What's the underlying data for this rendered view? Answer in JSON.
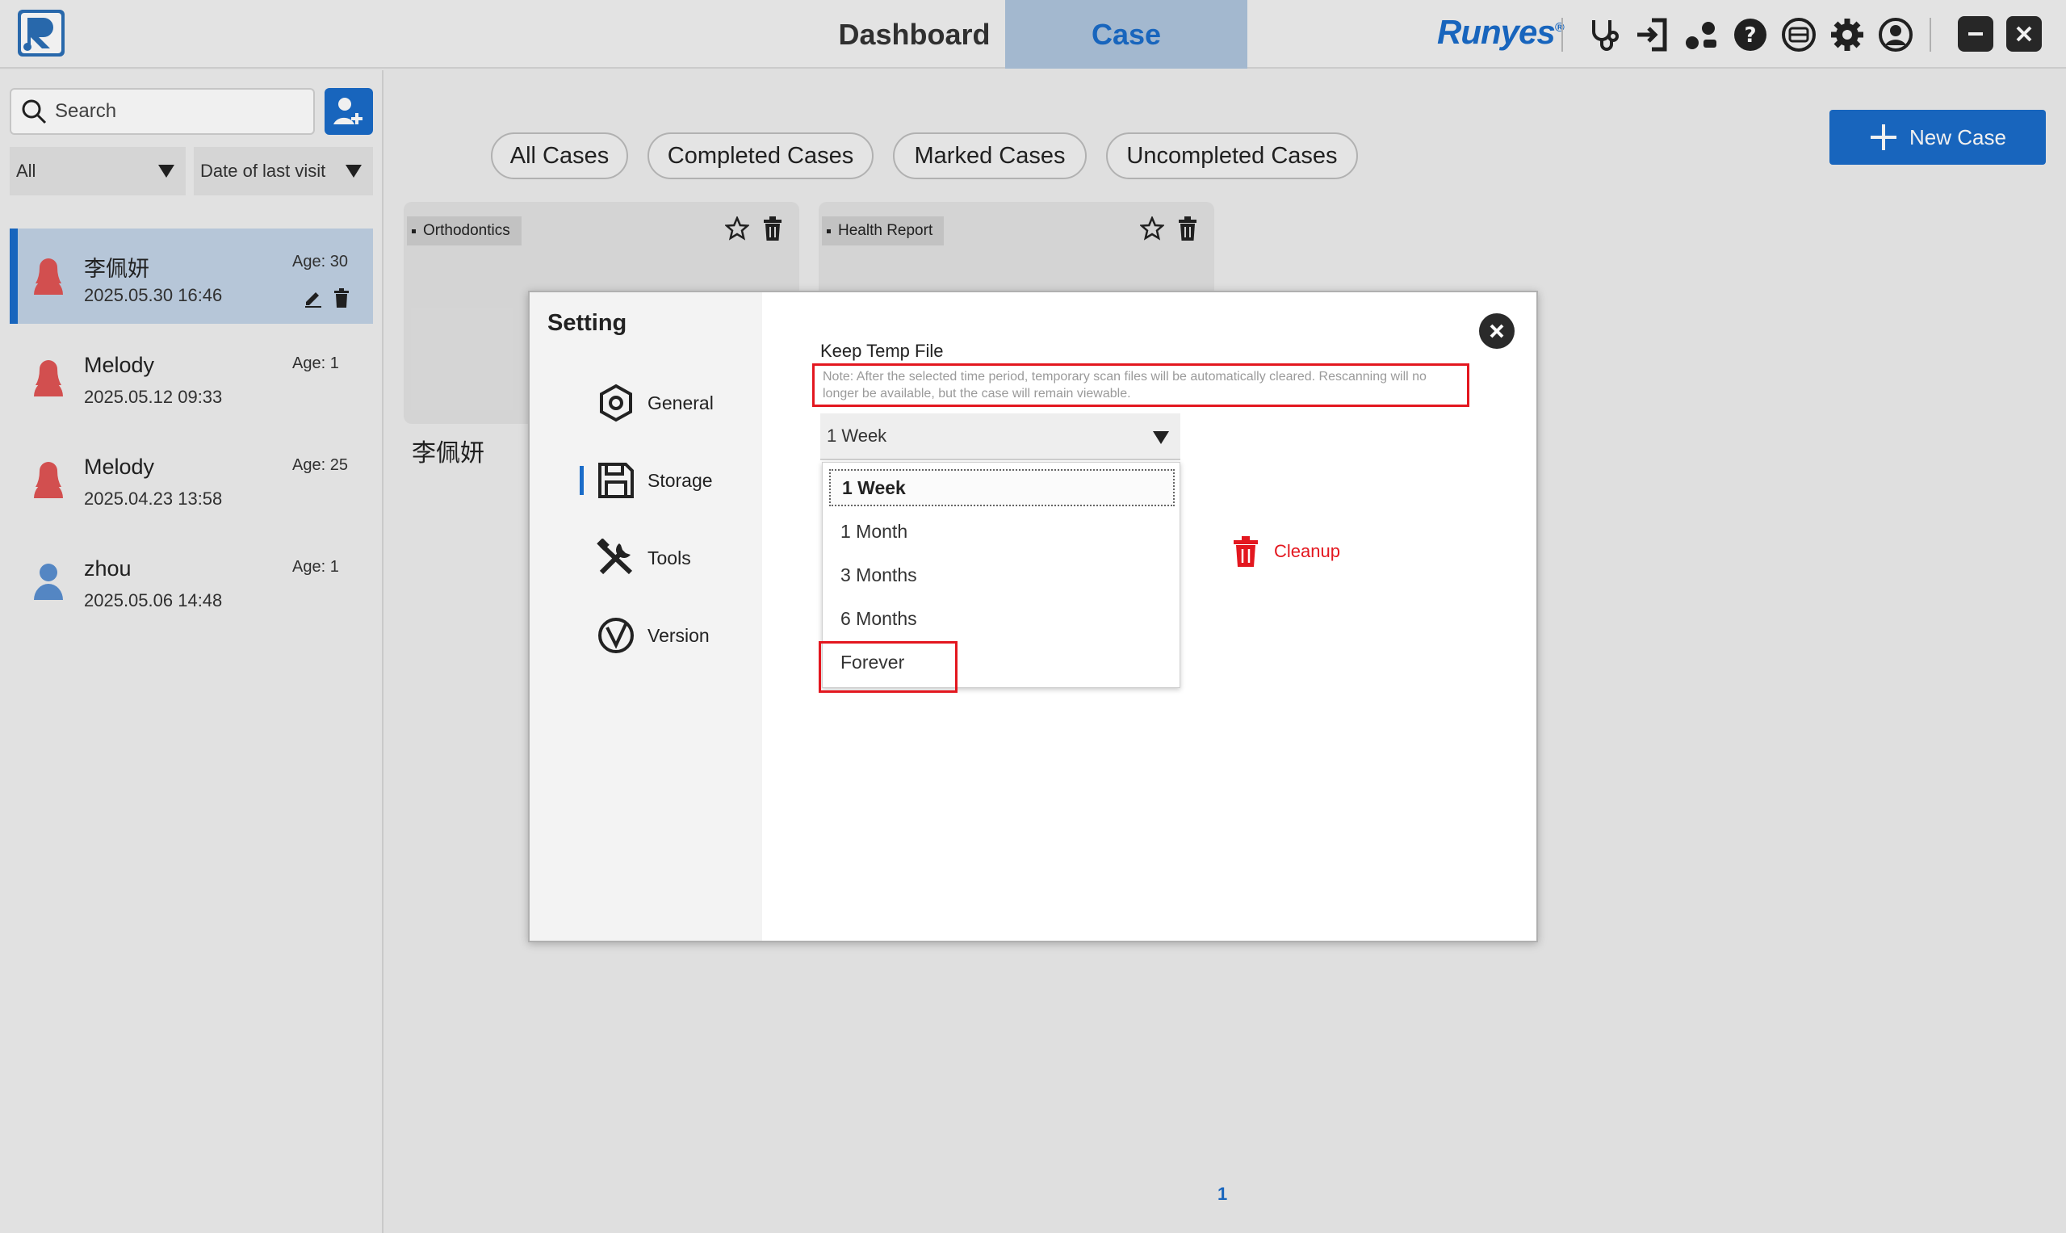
{
  "app": {
    "logo_icon": "runyes-r-logo-icon",
    "brand": "Runyes",
    "tabs": [
      {
        "label": "Dashboard",
        "active": false
      },
      {
        "label": "Case",
        "active": true
      }
    ],
    "toolbar_icons": [
      "stethoscope-icon",
      "import-icon",
      "share-icon",
      "help-icon",
      "scanner-icon",
      "settings-icon",
      "account-icon"
    ],
    "window_controls": [
      "minimize-icon",
      "close-icon"
    ],
    "accent_color": "#1a6cc9",
    "danger_color": "#e3171f"
  },
  "sidebar": {
    "search_placeholder": "Search",
    "filter_type": "All",
    "filter_sort": "Date of last visit",
    "patients": [
      {
        "name": "李佩妍",
        "date": "2025.05.30 16:46",
        "age": "Age: 30",
        "gender": "female",
        "selected": true
      },
      {
        "name": "Melody",
        "date": "2025.05.12 09:33",
        "age": "Age: 1",
        "gender": "female",
        "selected": false
      },
      {
        "name": "Melody",
        "date": "2025.04.23 13:58",
        "age": "Age: 25",
        "gender": "female",
        "selected": false
      },
      {
        "name": "zhou",
        "date": "2025.05.06 14:48",
        "age": "Age: 1",
        "gender": "male",
        "selected": false
      }
    ]
  },
  "main": {
    "filters": [
      "All Cases",
      "Completed Cases",
      "Marked Cases",
      "Uncompleted Cases"
    ],
    "new_case_label": "New Case",
    "cards": [
      {
        "tag": "Orthodontics"
      },
      {
        "tag": "Health Report"
      }
    ],
    "case_title": "李佩妍",
    "page": "1"
  },
  "dialog": {
    "title": "Setting",
    "menu": [
      {
        "label": "General",
        "icon": "hexagon-settings-icon",
        "active": false
      },
      {
        "label": "Storage",
        "icon": "floppy-disk-icon",
        "active": true
      },
      {
        "label": "Tools",
        "icon": "tools-icon",
        "active": false
      },
      {
        "label": "Version",
        "icon": "version-icon",
        "active": false
      }
    ],
    "keep_temp_label": "Keep Temp File",
    "note": "Note: After the selected time period, temporary scan files will be automatically cleared. Rescanning will no longer be available, but the case will remain viewable.",
    "selected_value": "1 Week",
    "options": [
      "1 Week",
      "1 Month",
      "3 Months",
      "6 Months",
      "Forever"
    ],
    "cleanup_label": "Cleanup"
  }
}
